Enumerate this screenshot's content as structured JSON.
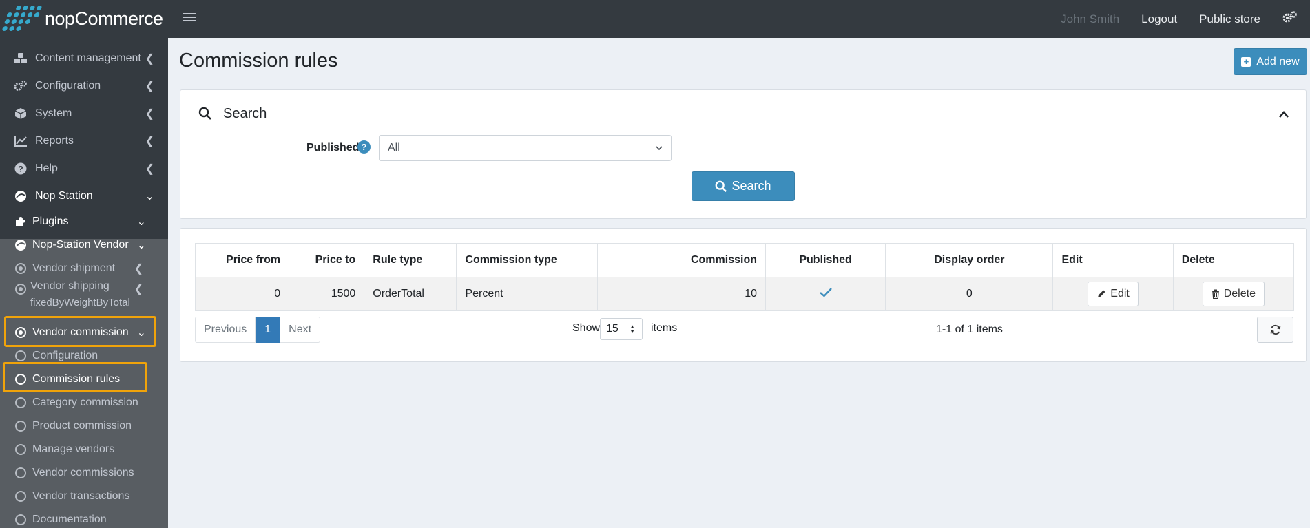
{
  "app": {
    "logo_text": "nopCommerce"
  },
  "header": {
    "user_name": "John Smith",
    "logout": "Logout",
    "public_store": "Public store"
  },
  "sidebar": {
    "items": [
      {
        "label": "Content management",
        "icon": "cubes-icon"
      },
      {
        "label": "Configuration",
        "icon": "gears-icon"
      },
      {
        "label": "System",
        "icon": "cube-icon"
      },
      {
        "label": "Reports",
        "icon": "line-chart-icon"
      },
      {
        "label": "Help",
        "icon": "question-circle-icon"
      },
      {
        "label": "Nop Station",
        "icon": "nopstation-icon"
      },
      {
        "label": "Plugins",
        "icon": "puzzle-icon"
      },
      {
        "label": "Nop-Station Vendor",
        "icon": "nopstation-icon"
      },
      {
        "label": "Vendor shipment"
      },
      {
        "label": "Vendor shipping",
        "label2": "fixedByWeightByTotal"
      },
      {
        "label": "Vendor commission"
      },
      {
        "label": "Configuration"
      },
      {
        "label": "Commission rules"
      },
      {
        "label": "Category commission"
      },
      {
        "label": "Product commission"
      },
      {
        "label": "Manage vendors"
      },
      {
        "label": "Vendor commissions"
      },
      {
        "label": "Vendor transactions"
      },
      {
        "label": "Documentation"
      }
    ]
  },
  "page": {
    "title": "Commission rules",
    "add_new": "Add new"
  },
  "search": {
    "title": "Search",
    "published_label": "Published",
    "published_value": "All",
    "search_button": "Search"
  },
  "grid": {
    "columns": [
      "Price from",
      "Price to",
      "Rule type",
      "Commission type",
      "Commission",
      "Published",
      "Display order",
      "Edit",
      "Delete"
    ],
    "rows": [
      {
        "price_from": "0",
        "price_to": "1500",
        "rule_type": "OrderTotal",
        "commission_type": "Percent",
        "commission": "10",
        "published": true,
        "display_order": "0",
        "edit": "Edit",
        "delete": "Delete"
      }
    ]
  },
  "pager": {
    "previous": "Previous",
    "current": "1",
    "next": "Next",
    "show": "Show",
    "page_size": "15",
    "items": "items",
    "range": "1-1 of 1 items"
  },
  "colors": {
    "accent": "#3c8dbc",
    "sidebar": "#343a40",
    "highlight": "#f0a30a"
  }
}
